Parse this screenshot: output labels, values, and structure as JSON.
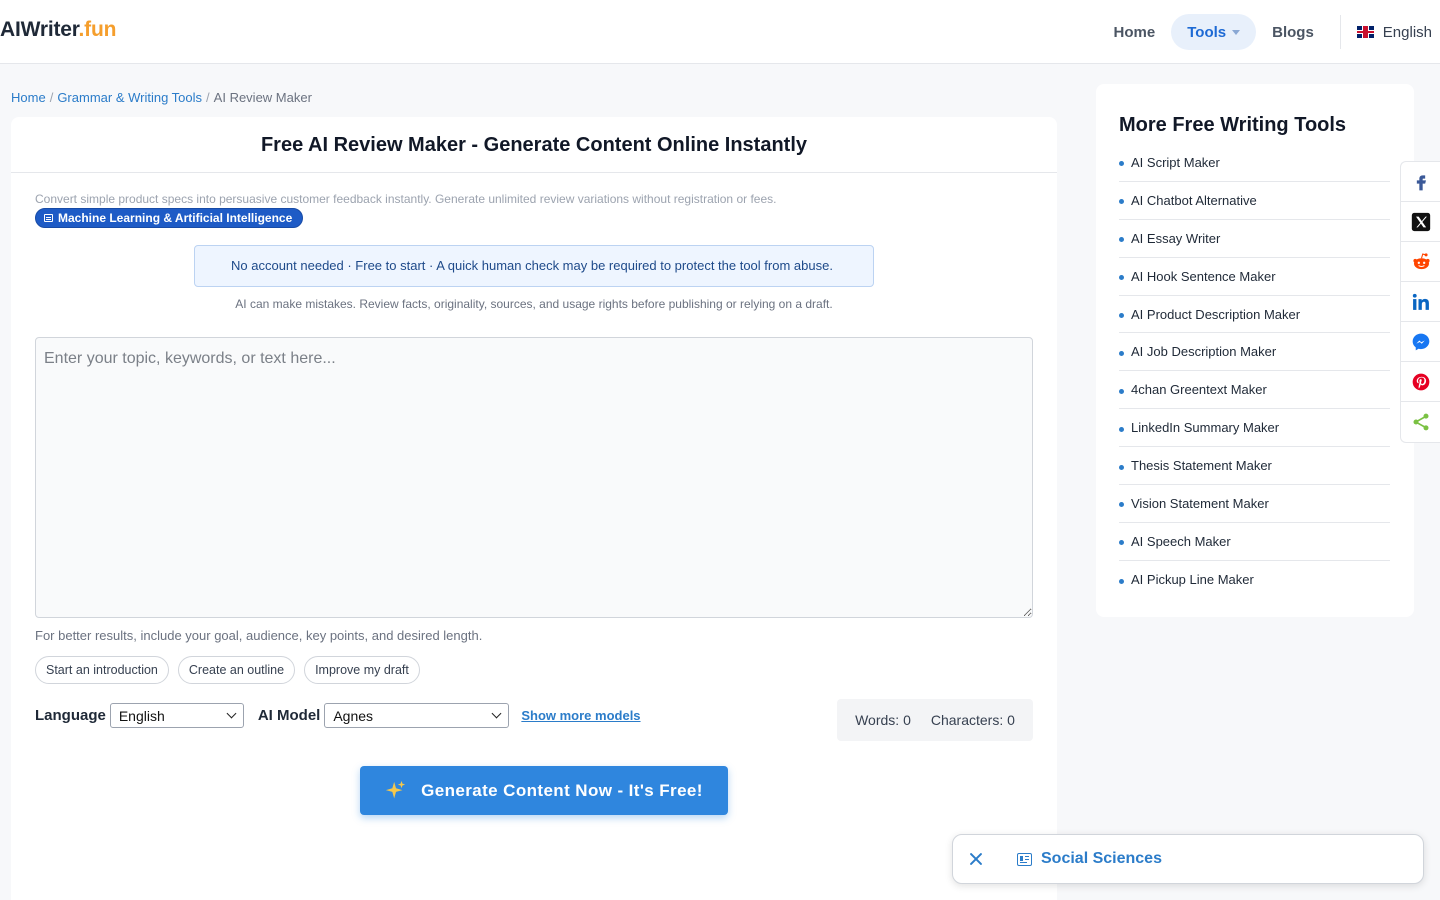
{
  "header": {
    "logo_main": "AIWriter",
    "logo_accent": ".fun",
    "nav": {
      "home": "Home",
      "tools": "Tools",
      "blogs": "Blogs",
      "language": "English"
    }
  },
  "breadcrumb": {
    "home": "Home",
    "category": "Grammar & Writing Tools",
    "current": "AI Review Maker"
  },
  "tool": {
    "title": "Free AI Review Maker - Generate Content Online Instantly",
    "description": "Convert simple product specs into persuasive customer feedback instantly. Generate unlimited review variations without registration or fees.",
    "badge": "Machine Learning & Artificial Intelligence",
    "notice": "No account needed · Free to start · A quick human check may be required to protect the tool from abuse.",
    "warning": "AI can make mistakes. Review facts, originality, sources, and usage rights before publishing or relying on a draft.",
    "input_placeholder": "Enter your topic, keywords, or text here...",
    "hint": "For better results, include your goal, audience, key points, and desired length.",
    "chips": [
      "Start an introduction",
      "Create an outline",
      "Improve my draft"
    ],
    "language_label": "Language",
    "language_value": "English",
    "model_label": "AI Model",
    "model_value": "Agnes",
    "show_more": "Show more models",
    "words": "Words: 0",
    "characters": "Characters: 0",
    "generate_label": "Generate Content Now - It's Free!"
  },
  "sidebar": {
    "title": "More Free Writing Tools",
    "items": [
      "AI Script Maker",
      "AI Chatbot Alternative",
      "AI Essay Writer",
      "AI Hook Sentence Maker",
      "AI Product Description Maker",
      "AI Job Description Maker",
      "4chan Greentext Maker",
      "LinkedIn Summary Maker",
      "Thesis Statement Maker",
      "Vision Statement Maker",
      "AI Speech Maker",
      "AI Pickup Line Maker"
    ]
  },
  "share": [
    "facebook-icon",
    "x-icon",
    "reddit-icon",
    "linkedin-icon",
    "messenger-icon",
    "pinterest-icon",
    "share-icon"
  ],
  "toast": {
    "label": "Social Sciences"
  },
  "colors": {
    "accent": "#2f86de",
    "link": "#2b7cc9",
    "logo_accent": "#f59e2c",
    "badge": "#1e5bc6"
  }
}
